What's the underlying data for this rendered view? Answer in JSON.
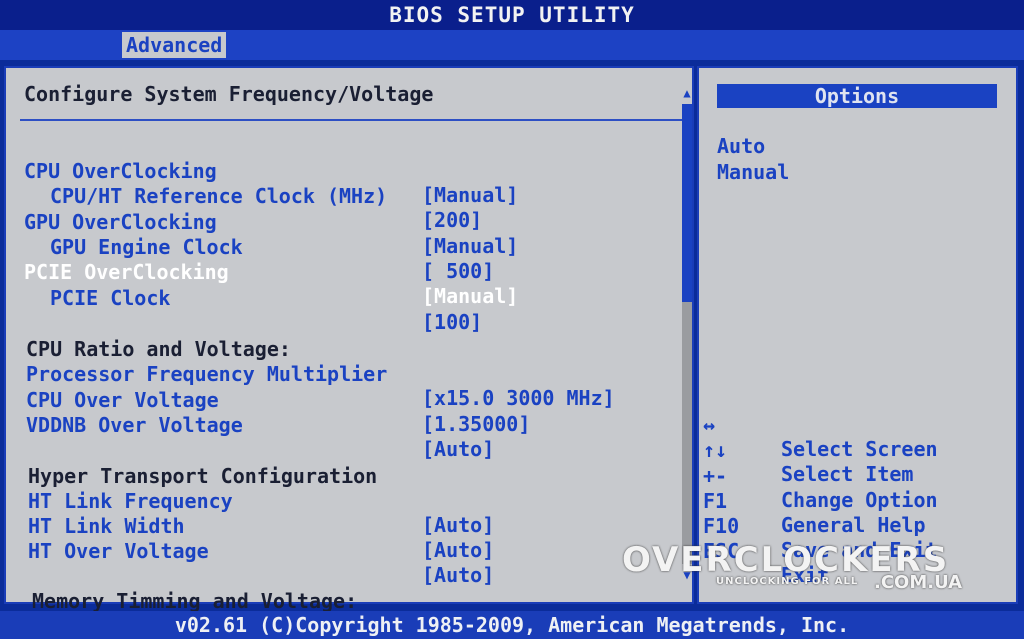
{
  "window": {
    "title": "BIOS SETUP UTILITY"
  },
  "tabs": [
    {
      "label": "Advanced",
      "active": true
    }
  ],
  "main": {
    "section_title": "Configure System Frequency/Voltage",
    "items": [
      {
        "label": "CPU OverClocking",
        "value": "[Manual]",
        "indent": false,
        "type": "link"
      },
      {
        "label": "CPU/HT Reference Clock (MHz)",
        "value": "[200]",
        "indent": true,
        "type": "link"
      },
      {
        "label": "GPU OverClocking",
        "value": "[Manual]",
        "indent": false,
        "type": "link"
      },
      {
        "label": "GPU Engine Clock",
        "value": "[ 500]",
        "indent": true,
        "type": "link"
      },
      {
        "label": "PCIE OverClocking",
        "value": "[Manual]",
        "indent": false,
        "type": "selected"
      },
      {
        "label": "PCIE Clock",
        "value": "[100]",
        "indent": true,
        "type": "link"
      },
      {
        "label": "CPU Ratio and Voltage:",
        "value": "",
        "indent": false,
        "type": "header"
      },
      {
        "label": "Processor Frequency Multiplier",
        "value": "[x15.0 3000 MHz]",
        "indent": false,
        "type": "link"
      },
      {
        "label": "CPU Over Voltage",
        "value": "[1.35000]",
        "indent": false,
        "type": "link"
      },
      {
        "label": "VDDNB Over Voltage",
        "value": "[Auto]",
        "indent": false,
        "type": "link"
      },
      {
        "label": "Hyper Transport Configuration",
        "value": "",
        "indent": false,
        "type": "header"
      },
      {
        "label": "HT Link Frequency",
        "value": "[Auto]",
        "indent": false,
        "type": "link"
      },
      {
        "label": "HT Link Width",
        "value": "[Auto]",
        "indent": false,
        "type": "link"
      },
      {
        "label": "HT Over Voltage",
        "value": "[Auto]",
        "indent": false,
        "type": "link"
      },
      {
        "label": "Memory Timming and Voltage:",
        "value": "",
        "indent": false,
        "type": "header"
      }
    ]
  },
  "options": {
    "header": "Options",
    "items": [
      "Auto",
      "Manual"
    ]
  },
  "help": [
    {
      "key": "↔",
      "desc": "Select Screen",
      "icon": "left-right-arrows-icon"
    },
    {
      "key": "↑↓",
      "desc": "Select Item",
      "icon": "up-down-arrows-icon"
    },
    {
      "key": "+-",
      "desc": "Change Option",
      "icon": "plus-minus-icon"
    },
    {
      "key": "F1",
      "desc": "General Help"
    },
    {
      "key": "F10",
      "desc": "Save and Exit"
    },
    {
      "key": "ESC",
      "desc": "Exit"
    }
  ],
  "watermark": {
    "main": "OVERCLOCKERS",
    "sub": "UNCLOCKING FOR ALL",
    "domain": ".COM.UA"
  },
  "footer": {
    "copyright": "v02.61 (C)Copyright 1985-2009, American Megatrends, Inc."
  },
  "colors": {
    "background": "#0b2c9a",
    "panel": "#c7c9cd",
    "accent": "#1a42c2",
    "selected_text": "#ffffff",
    "heading_text": "#1a1f33"
  }
}
